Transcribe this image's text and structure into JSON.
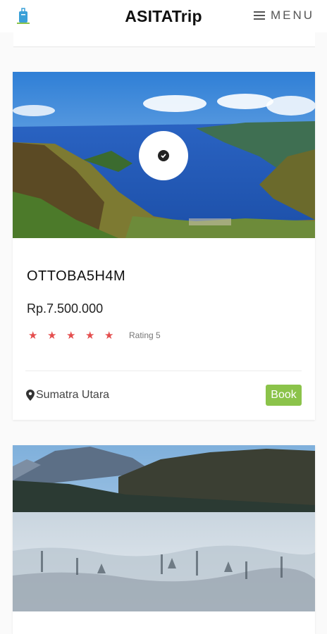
{
  "header": {
    "brand": "ASITATrip",
    "menu_label": "MENU",
    "logo_icon": "suitcase-logo-icon",
    "menu_icon": "hamburger-icon"
  },
  "cards": [
    {
      "title": "OTTOBA5H4M",
      "price": "Rp.7.500.000",
      "rating_value": 5,
      "rating_text": "Rating 5",
      "location": "Sumatra Utara",
      "book_label": "Book",
      "badge_icon": "check-circle-icon",
      "location_icon": "map-pin-icon"
    }
  ],
  "colors": {
    "star": "#e44d4d",
    "book_button": "#8bc34a",
    "brand_text": "#111111"
  }
}
